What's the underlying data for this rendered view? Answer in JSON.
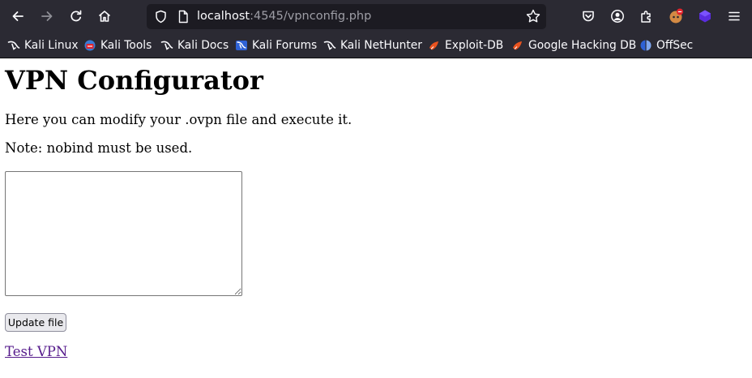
{
  "browser": {
    "url_host": "localhost",
    "url_rest": ":4545/vpnconfig.php",
    "bookmarks": [
      {
        "label": "Kali Linux",
        "icon": "kali-dragon-icon"
      },
      {
        "label": "Kali Tools",
        "icon": "kali-tools-icon"
      },
      {
        "label": "Kali Docs",
        "icon": "kali-dragon-icon"
      },
      {
        "label": "Kali Forums",
        "icon": "kali-forums-icon"
      },
      {
        "label": "Kali NetHunter",
        "icon": "kali-dragon-icon"
      },
      {
        "label": "Exploit-DB",
        "icon": "exploit-db-icon"
      },
      {
        "label": "Google Hacking DB",
        "icon": "exploit-db-icon"
      },
      {
        "label": "OffSec",
        "icon": "offsec-icon"
      }
    ],
    "accent_colors": {
      "chrome_bg": "#2b2a33",
      "urlbar_bg": "#1c1b22",
      "exploit_orange": "#e9531f",
      "offsec_blue": "#2e62d6"
    }
  },
  "page": {
    "title": "VPN Configurator",
    "intro": "Here you can modify your .ovpn file and execute it.",
    "note": "Note: nobind must be used.",
    "textarea_value": "",
    "update_button_label": "Update file",
    "test_link_label": "Test VPN",
    "link_color": "#551a8b"
  }
}
